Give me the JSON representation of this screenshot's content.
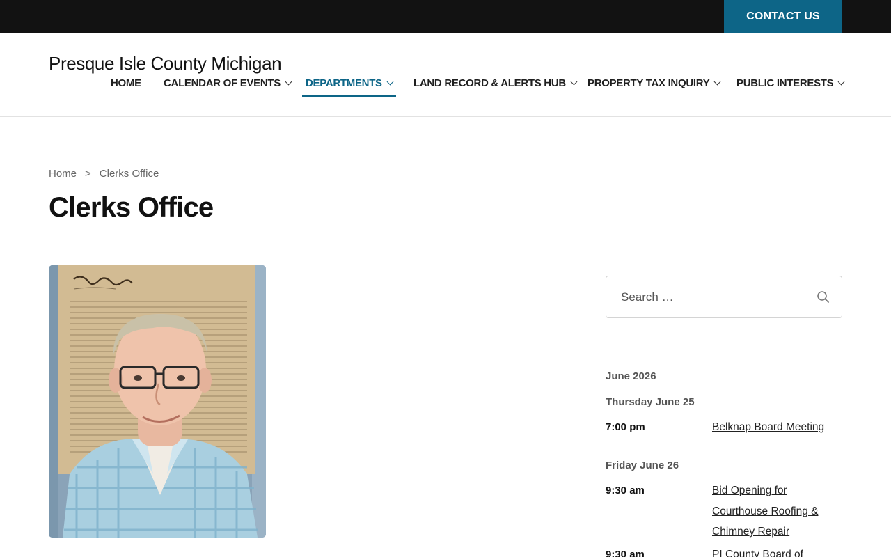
{
  "topbar": {
    "contact_label": "CONTACT US"
  },
  "header": {
    "site_title": "Presque Isle County Michigan",
    "nav": [
      {
        "label": "HOME",
        "has_dropdown": false
      },
      {
        "label": "CALENDAR OF EVENTS",
        "has_dropdown": true
      },
      {
        "label": "DEPARTMENTS",
        "has_dropdown": true,
        "active": true
      },
      {
        "label": "LAND RECORD & ALERTS HUB",
        "has_dropdown": true
      },
      {
        "label": "PROPERTY TAX INQUIRY",
        "has_dropdown": true
      },
      {
        "label": "PUBLIC INTERESTS",
        "has_dropdown": true
      }
    ]
  },
  "breadcrumb": {
    "home": "Home",
    "separator": ">",
    "current": "Clerks Office"
  },
  "page_title": "Clerks Office",
  "sidebar": {
    "search": {
      "placeholder": "Search …"
    },
    "calendar": {
      "month": "June 2026",
      "days": [
        {
          "label": "Thursday June 25",
          "events": [
            {
              "time": "7:00 pm",
              "title": "Belknap Board Meeting"
            }
          ]
        },
        {
          "label": "Friday June 26",
          "events": [
            {
              "time": "9:30 am",
              "title": "Bid Opening for Courthouse Roofing & Chimney Repair"
            },
            {
              "time": "9:30 am",
              "title": "PI County Board of"
            }
          ]
        }
      ]
    }
  },
  "colors": {
    "accent": "#0d6587",
    "topbar": "#121212"
  }
}
